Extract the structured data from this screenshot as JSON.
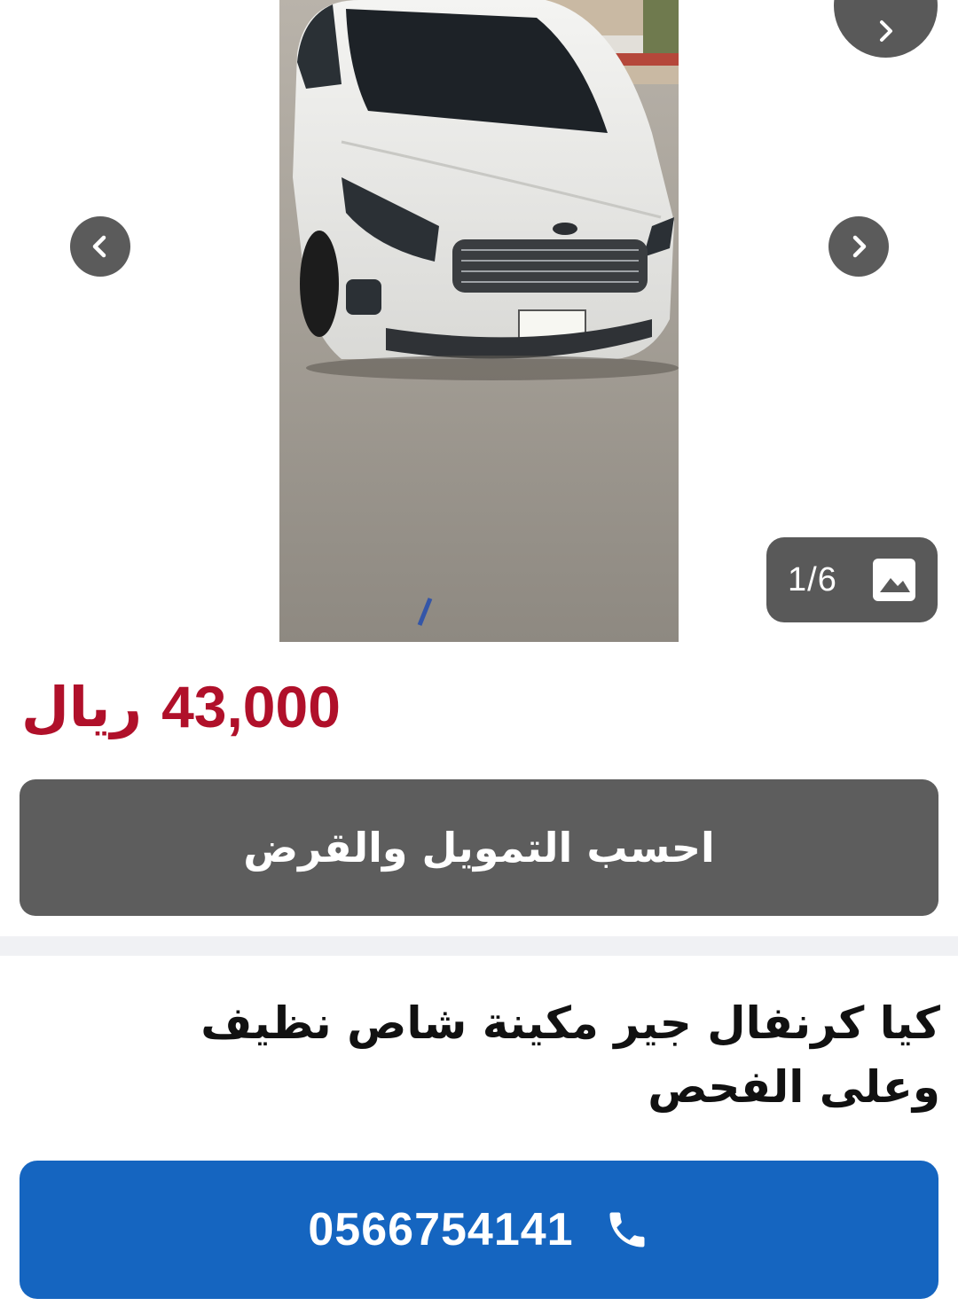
{
  "gallery": {
    "counter": "1/6",
    "photo_alt": "",
    "icons": {
      "prev": "chevron-left-icon",
      "next": "chevron-right-icon",
      "counter": "image-icon"
    }
  },
  "listing": {
    "price_value": "43,000",
    "price_currency": "ريال",
    "title": "كيا كرنفال جير مكينة شاص نظيف وعلى الفحص"
  },
  "actions": {
    "finance_label": "احسب التمويل والقرض",
    "phone_number": "0566754141",
    "phone_icon": "phone-icon"
  },
  "colors": {
    "price": "#b0102a",
    "finance_button": "#5d5d5d",
    "phone_button": "#1565c0",
    "overlay": "#595959"
  }
}
